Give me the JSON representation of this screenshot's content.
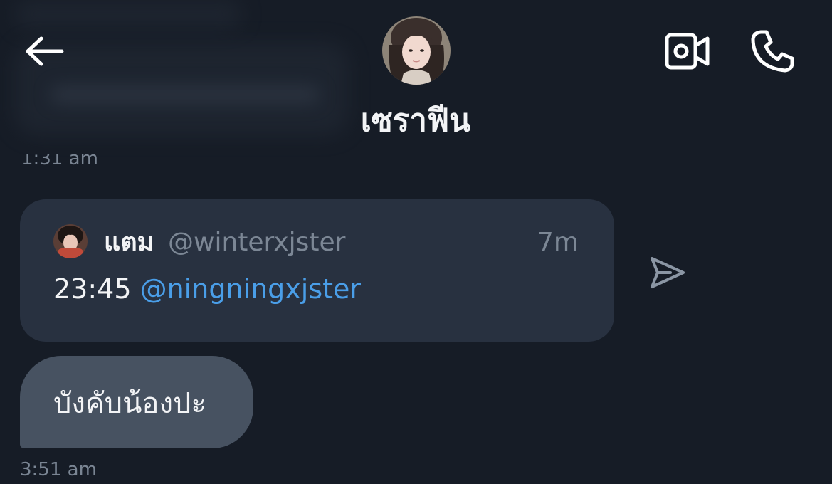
{
  "header": {
    "contact_name": "เซราฟีน",
    "back_icon": "arrow-left-icon",
    "video_icon": "video-camera-icon",
    "call_icon": "phone-icon"
  },
  "conversation": {
    "earlier_timestamp": "1:31 am",
    "shared_tweet": {
      "author_name": "แตม",
      "author_handle": "@winterxjster",
      "age": "7m",
      "text_prefix": "23:45 ",
      "mention": "@ningningxjster"
    },
    "share_icon": "send-arrow-icon",
    "message": {
      "text": "บังคับน้องปะ",
      "timestamp": "3:51 am"
    }
  },
  "colors": {
    "background": "#161c26",
    "card": "#283140",
    "bubble": "#475261",
    "mention": "#4a9ee8",
    "muted": "#7c8795"
  }
}
